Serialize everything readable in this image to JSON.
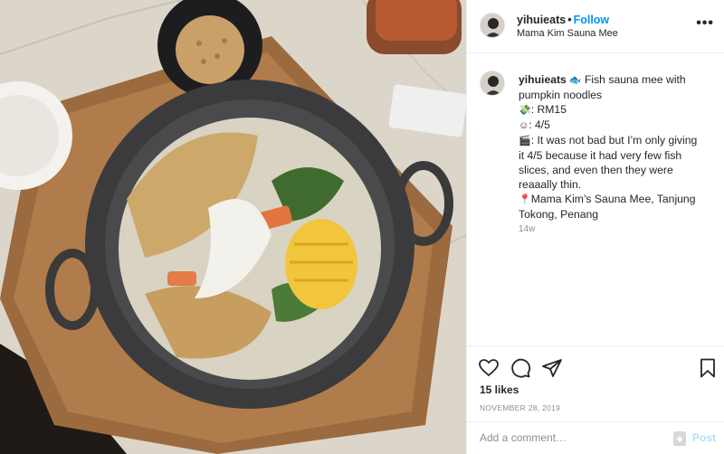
{
  "post": {
    "username": "yihuieats",
    "follow_label": "Follow",
    "location": "Mama Kim Sauna Mee",
    "more_label": "•••"
  },
  "caption": {
    "username": "yihuieats",
    "lines": [
      "Fish sauna mee with",
      "pumpkin noodles",
      ": RM15",
      ": 4/5",
      ": It was not bad but I’m only giving",
      "it 4/5 because it had very few fish",
      "slices, and even then they were",
      "reaaally thin.",
      "Mama Kim’s Sauna Mee, Tanjung",
      "Tokong, Penang"
    ],
    "time_ago": "14w"
  },
  "stats": {
    "likes": "15 likes",
    "date": "NOVEMBER 28, 2019"
  },
  "composer": {
    "placeholder": "Add a comment…",
    "post_label": "Post"
  },
  "icons": {
    "like": "heart-icon",
    "comment": "comment-icon",
    "share": "paper-plane-icon",
    "save": "bookmark-icon"
  },
  "colors": {
    "accent": "#0095f6",
    "post_disabled": "#b2dffc",
    "muted": "#8e8e8e"
  }
}
